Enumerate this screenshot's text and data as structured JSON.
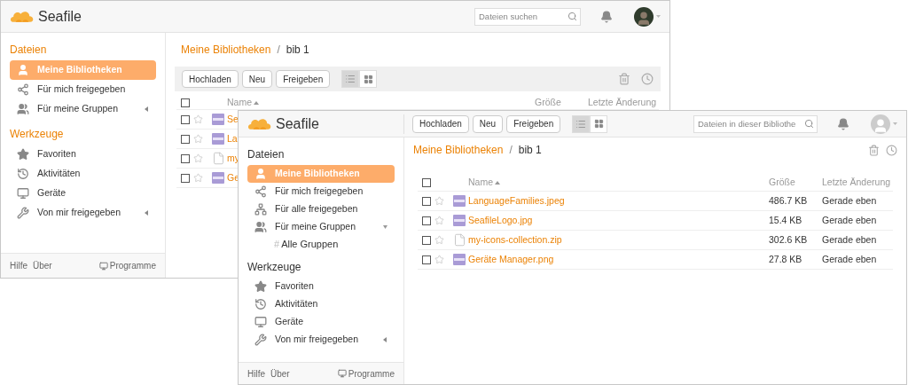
{
  "windows": [
    {
      "kind": "classic",
      "logo": "Seafile",
      "search": {
        "placeholder": "Dateien suchen"
      },
      "sidebar": {
        "sections": [
          {
            "title": "Dateien",
            "items": [
              {
                "kind": "mine",
                "label": "Meine Bibliotheken",
                "selected": true
              },
              {
                "kind": "shared-with-me",
                "label": "Für mich freigegeben",
                "selected": false
              },
              {
                "kind": "groups",
                "label": "Für meine Gruppen",
                "selected": false,
                "expanded": false
              }
            ]
          },
          {
            "title": "Werkzeuge",
            "items": [
              {
                "kind": "favorites",
                "label": "Favoriten",
                "selected": false
              },
              {
                "kind": "activities",
                "label": "Aktivitäten",
                "selected": false
              },
              {
                "kind": "devices",
                "label": "Geräte",
                "selected": false
              },
              {
                "kind": "shared-by-me",
                "label": "Von mir freigegeben",
                "selected": false,
                "expanded": false
              }
            ]
          }
        ],
        "footer": {
          "links": [
            "Hilfe",
            "Über"
          ],
          "apps": "Programme"
        }
      },
      "breadcrumb": {
        "items": [
          "Meine Bibliotheken",
          "bib 1"
        ],
        "separator": "/"
      },
      "toolbar": {
        "buttons": [
          "Hochladen",
          "Neu",
          "Freigeben"
        ],
        "view_modes": [
          {
            "kind": "list",
            "selected": true
          },
          {
            "kind": "grid",
            "selected": false
          }
        ]
      },
      "table": {
        "all_checked": false,
        "columns": [
          "Name",
          "Größe",
          "Letzte Änderung"
        ],
        "rows": [
          {
            "kind": "image",
            "name": "Se",
            "checked": false,
            "starred": false
          },
          {
            "kind": "image",
            "name": "La",
            "checked": false,
            "starred": false
          },
          {
            "kind": "file",
            "name": "my",
            "checked": false,
            "starred": false
          },
          {
            "kind": "image",
            "name": "Ge",
            "checked": false,
            "starred": false
          }
        ]
      }
    },
    {
      "kind": "compact",
      "logo": "Seafile",
      "search": {
        "placeholder": "Dateien in dieser Bibliothe"
      },
      "sidebar": {
        "sections": [
          {
            "title": "Dateien",
            "items": [
              {
                "kind": "mine",
                "label": "Meine Bibliotheken",
                "selected": true
              },
              {
                "kind": "shared-with-me",
                "label": "Für mich freigegeben",
                "selected": false
              },
              {
                "kind": "shared-all",
                "label": "Für alle freigegeben",
                "selected": false
              },
              {
                "kind": "groups",
                "label": "Für meine Gruppen",
                "selected": false,
                "expanded": true,
                "children": [
                  {
                    "mark": "#",
                    "label": "Alle Gruppen"
                  }
                ]
              }
            ]
          },
          {
            "title": "Werkzeuge",
            "items": [
              {
                "kind": "favorites",
                "label": "Favoriten",
                "selected": false
              },
              {
                "kind": "activities",
                "label": "Aktivitäten",
                "selected": false
              },
              {
                "kind": "devices",
                "label": "Geräte",
                "selected": false
              },
              {
                "kind": "shared-by-me",
                "label": "Von mir freigegeben",
                "selected": false,
                "expanded": false
              }
            ]
          }
        ],
        "footer": {
          "links": [
            "Hilfe",
            "Über"
          ],
          "apps": "Programme"
        }
      },
      "header_toolbar": {
        "buttons": [
          "Hochladen",
          "Neu",
          "Freigeben"
        ],
        "view_modes": [
          {
            "kind": "list",
            "selected": true
          },
          {
            "kind": "grid",
            "selected": false
          }
        ]
      },
      "breadcrumb": {
        "items": [
          "Meine Bibliotheken",
          "bib 1"
        ],
        "separator": "/"
      },
      "table": {
        "all_checked": false,
        "columns": [
          "Name",
          "Größe",
          "Letzte Änderung"
        ],
        "rows": [
          {
            "kind": "image",
            "name": "LanguageFamilies.jpeg",
            "size": "486.7 KB",
            "modified": "Gerade eben",
            "checked": false,
            "starred": false
          },
          {
            "kind": "image",
            "name": "SeafileLogo.jpg",
            "size": "15.4 KB",
            "modified": "Gerade eben",
            "checked": false,
            "starred": false
          },
          {
            "kind": "file",
            "name": "my-icons-collection.zip",
            "size": "302.6 KB",
            "modified": "Gerade eben",
            "checked": false,
            "starred": false
          },
          {
            "kind": "image",
            "name": "Geräte Manager.png",
            "size": "27.8 KB",
            "modified": "Gerade eben",
            "checked": false,
            "starred": false
          }
        ]
      }
    }
  ]
}
